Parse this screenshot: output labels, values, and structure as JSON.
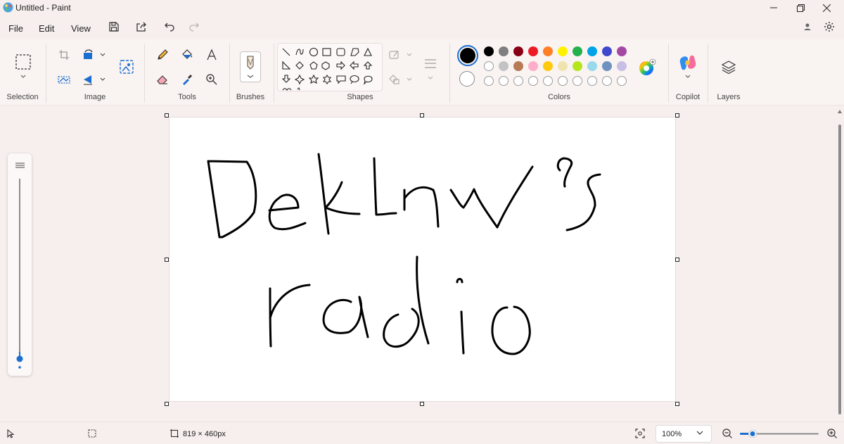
{
  "window": {
    "title": "Untitled - Paint"
  },
  "menu": {
    "file": "File",
    "edit": "Edit",
    "view": "View"
  },
  "ribbon": {
    "groups": {
      "selection": "Selection",
      "image": "Image",
      "tools": "Tools",
      "brushes": "Brushes",
      "shapes": "Shapes",
      "colors": "Colors",
      "copilot": "Copilot",
      "layers": "Layers"
    },
    "colors": {
      "primary": "#000000",
      "secondary": "#ffffff",
      "row1": [
        "#000000",
        "#7f7f7f",
        "#880015",
        "#ed1c24",
        "#ff7f27",
        "#fff200",
        "#22b14c",
        "#00a2e8",
        "#3f48cc",
        "#a349a4"
      ],
      "row2": [
        "#ffffff",
        "#c3c3c3",
        "#b97a57",
        "#ffaec9",
        "#ffc90e",
        "#efe4b0",
        "#b5e61d",
        "#99d9ea",
        "#7092be",
        "#c8bfe7"
      ],
      "row3_count": 10
    }
  },
  "canvas": {
    "drawn_text_line1": "Deklnw's",
    "drawn_text_line2": "radio"
  },
  "status": {
    "canvas_size": "819 × 460px",
    "zoom": "100%"
  },
  "icons": {
    "app": "paint-app-icon",
    "minimize": "minimize-icon",
    "maximize": "restore-icon",
    "close": "close-icon"
  }
}
